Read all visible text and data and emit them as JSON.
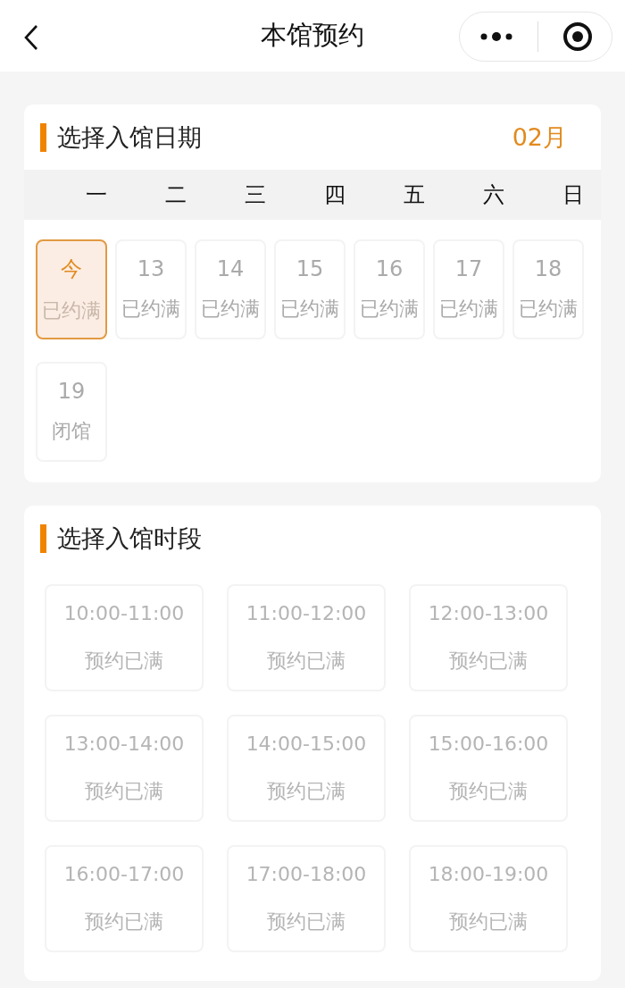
{
  "nav": {
    "title": "本馆预约"
  },
  "date_section": {
    "title": "选择入馆日期",
    "month": "02月",
    "weekdays": [
      "一",
      "二",
      "三",
      "四",
      "五",
      "六",
      "日"
    ],
    "days": [
      {
        "label": "今",
        "status": "已约满",
        "selected": true
      },
      {
        "label": "13",
        "status": "已约满",
        "selected": false
      },
      {
        "label": "14",
        "status": "已约满",
        "selected": false
      },
      {
        "label": "15",
        "status": "已约满",
        "selected": false
      },
      {
        "label": "16",
        "status": "已约满",
        "selected": false
      },
      {
        "label": "17",
        "status": "已约满",
        "selected": false
      },
      {
        "label": "18",
        "status": "已约满",
        "selected": false
      },
      {
        "label": "19",
        "status": "闭馆",
        "selected": false
      }
    ]
  },
  "time_section": {
    "title": "选择入馆时段",
    "slots": [
      {
        "time": "10:00-11:00",
        "status": "预约已满",
        "disabled": true
      },
      {
        "time": "11:00-12:00",
        "status": "预约已满",
        "disabled": true
      },
      {
        "time": "12:00-13:00",
        "status": "预约已满",
        "disabled": true
      },
      {
        "time": "13:00-14:00",
        "status": "预约已满",
        "disabled": true
      },
      {
        "time": "14:00-15:00",
        "status": "预约已满",
        "disabled": true
      },
      {
        "time": "15:00-16:00",
        "status": "预约已满",
        "disabled": true
      },
      {
        "time": "16:00-17:00",
        "status": "预约已满",
        "disabled": true
      },
      {
        "time": "17:00-18:00",
        "status": "预约已满",
        "disabled": true
      },
      {
        "time": "18:00-19:00",
        "status": "预约已满",
        "disabled": true
      }
    ]
  }
}
